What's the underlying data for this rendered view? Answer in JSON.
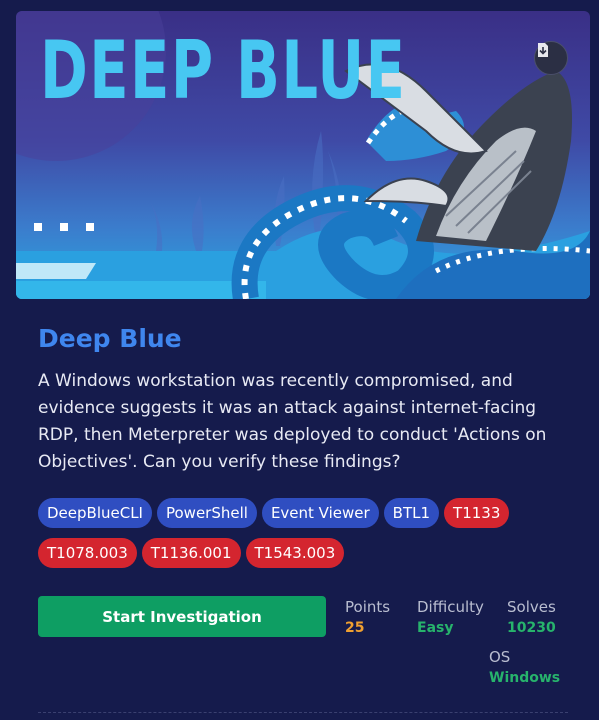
{
  "banner": {
    "title": "DEEP BLUE",
    "download_icon": "download-icon"
  },
  "challenge": {
    "title": "Deep Blue",
    "description": "A Windows workstation was recently compromised, and evidence suggests it was an attack against internet-facing RDP, then Meterpreter was deployed to conduct 'Actions on Objectives'. Can you verify these findings?"
  },
  "tags": [
    {
      "label": "DeepBlueCLI",
      "color": "blue"
    },
    {
      "label": "PowerShell",
      "color": "blue"
    },
    {
      "label": "Event Viewer",
      "color": "blue"
    },
    {
      "label": "BTL1",
      "color": "blue"
    },
    {
      "label": "T1133",
      "color": "red"
    },
    {
      "label": "T1078.003",
      "color": "red"
    },
    {
      "label": "T1136.001",
      "color": "red"
    },
    {
      "label": "T1543.003",
      "color": "red"
    }
  ],
  "actions": {
    "start_label": "Start Investigation"
  },
  "stats": {
    "points": {
      "label": "Points",
      "value": "25",
      "color": "#f0a030"
    },
    "difficulty": {
      "label": "Difficulty",
      "value": "Easy",
      "color": "#27b36c"
    },
    "solves": {
      "label": "Solves",
      "value": "10230",
      "color": "#27b36c"
    },
    "os": {
      "label": "OS",
      "value": "Windows",
      "color": "#27b36c"
    }
  },
  "colors": {
    "accent_title": "#3f86ee",
    "tag_blue": "#2f4ec1",
    "tag_red": "#d4252f",
    "button_green": "#0e9e63"
  }
}
